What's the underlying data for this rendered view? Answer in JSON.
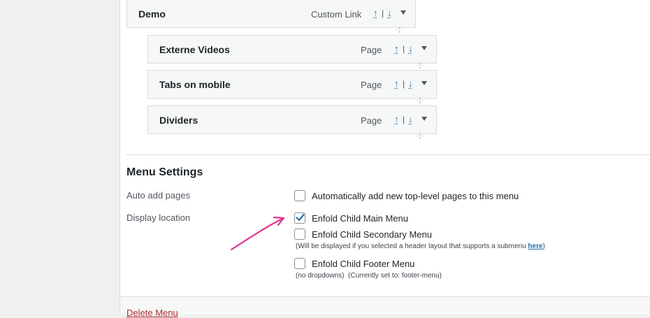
{
  "menu_items": [
    {
      "title": "Demo",
      "type": "Custom Link",
      "move_up": "↑",
      "move_down": "↓",
      "sep": "|"
    },
    {
      "title": "Externe Videos",
      "type": "Page",
      "move_up": "↑",
      "move_down": "↓",
      "sep": "|"
    },
    {
      "title": "Tabs on mobile",
      "type": "Page",
      "move_up": "↑",
      "move_down": "↓",
      "sep": "|"
    },
    {
      "title": "Dividers",
      "type": "Page",
      "move_up": "↑",
      "move_down": "↓",
      "sep": "|"
    }
  ],
  "menu_settings": {
    "heading": "Menu Settings",
    "auto_add_label": "Auto add pages",
    "auto_add_option": "Automatically add new top-level pages to this menu",
    "auto_add_checked": false,
    "display_location_label": "Display location",
    "locations": [
      {
        "label": "Enfold Child Main Menu",
        "checked": true
      },
      {
        "label": "Enfold Child Secondary Menu",
        "checked": false
      },
      {
        "label": "Enfold Child Footer Menu",
        "checked": false
      }
    ],
    "secondary_note_prefix": "(Will be displayed if you selected a header layout that supports a submenu ",
    "secondary_note_link": "here",
    "secondary_note_suffix": ")",
    "footer_note": "(no dropdowns)  (Currently set to: footer-menu)"
  },
  "delete_menu_label": "Delete Menu",
  "colors": {
    "accent": "#2271b1",
    "annotation_arrow": "#e0338f",
    "delete": "#b32d2e"
  }
}
